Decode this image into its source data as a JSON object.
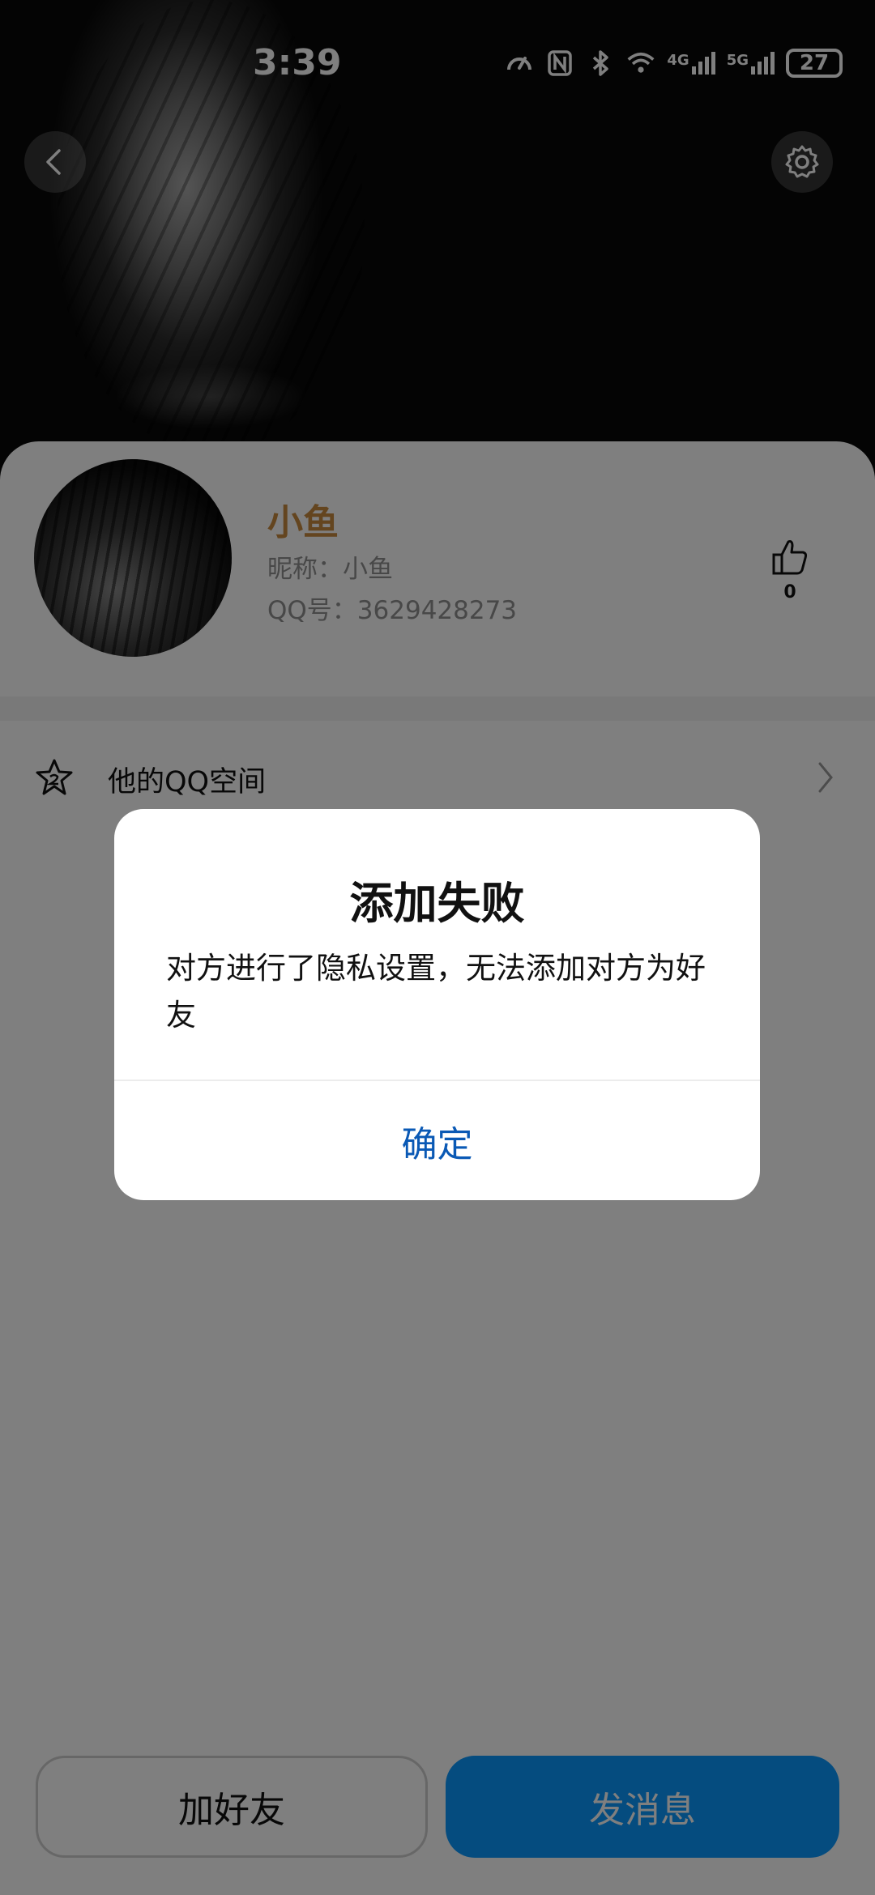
{
  "status_bar": {
    "time": "3:39",
    "battery": "27",
    "network_4g": "4G",
    "network_5g": "5G"
  },
  "header": {
    "back_icon": "chevron-left-icon",
    "settings_icon": "gear-icon"
  },
  "profile": {
    "name": "小鱼",
    "nickname": "昵称：小鱼",
    "qq_number": "QQ号：3629428273",
    "like_count": "0",
    "name_color": "#c88a3f"
  },
  "menu": {
    "qzone_label": "他的QQ空间",
    "qzone_icon": "star-icon"
  },
  "bottom_actions": {
    "add_friend": "加好友",
    "send_message": "发消息",
    "accent_color": "#0a99ff"
  },
  "dialog": {
    "title": "添加失败",
    "message": "对方进行了隐私设置，无法添加对方为好友",
    "confirm": "确定",
    "confirm_color": "#0a59b5"
  }
}
